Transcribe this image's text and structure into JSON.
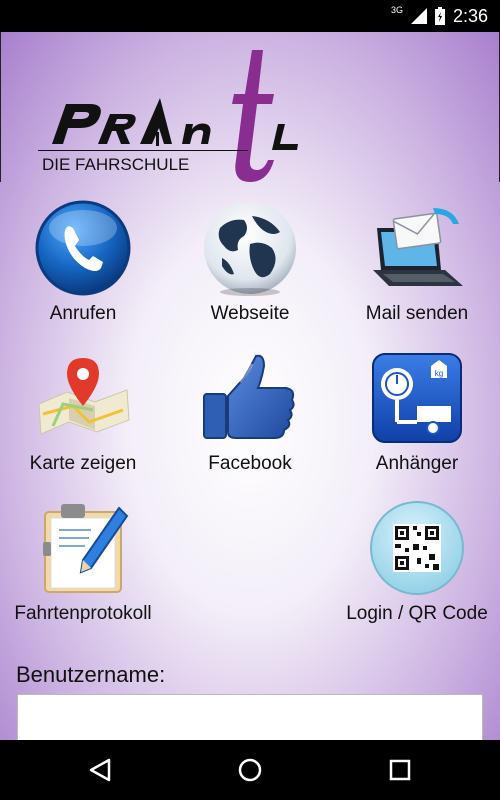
{
  "status_bar": {
    "time": "2:36",
    "network": "3G",
    "icons": [
      "signal-icon",
      "battery-icon"
    ]
  },
  "logo": {
    "wordmark": "PRAntL",
    "subtitle": "DIE FAHRSCHULE"
  },
  "tiles": [
    {
      "label": "Anrufen",
      "icon": "phone-icon"
    },
    {
      "label": "Webseite",
      "icon": "globe-icon"
    },
    {
      "label": "Mail senden",
      "icon": "mail-laptop-icon"
    },
    {
      "label": "Karte zeigen",
      "icon": "map-pin-icon"
    },
    {
      "label": "Facebook",
      "icon": "thumbs-up-icon"
    },
    {
      "label": "Anhänger",
      "icon": "trailer-weight-icon"
    },
    {
      "label": "Fahrtenprotokoll",
      "icon": "clipboard-pen-icon"
    },
    {
      "label": "Login / QR Code",
      "icon": "qr-code-icon"
    }
  ],
  "form": {
    "username_label": "Benutzername:",
    "username_value": ""
  },
  "nav": [
    "back-icon",
    "home-icon",
    "recents-icon"
  ],
  "colors": {
    "accent_purple": "#8a2d91",
    "background_edge": "#a77fcd",
    "phone_blue": "#1565c0",
    "facebook_blue": "#2e5fb5"
  }
}
